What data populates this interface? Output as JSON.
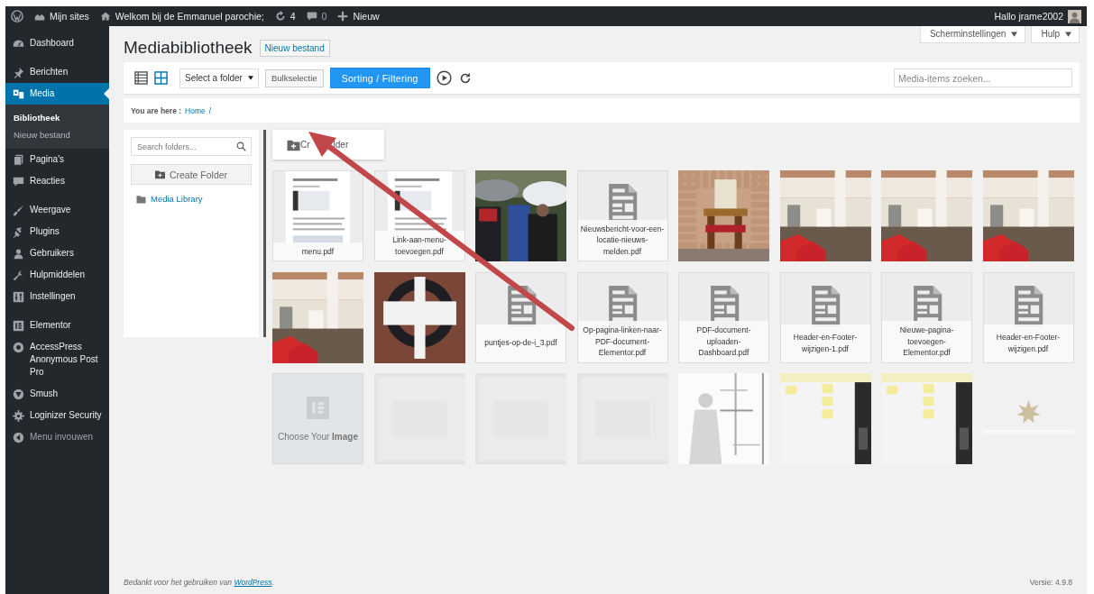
{
  "admin_bar": {
    "my_sites": "Mijn sites",
    "site_name": "Welkom bij de Emmanuel parochie;",
    "updates": "4",
    "comments": "0",
    "new": "Nieuw",
    "greeting": "Hallo jrame2002"
  },
  "sidebar": {
    "groups": [
      {
        "items": [
          {
            "label": "Dashboard",
            "selected": false
          }
        ]
      },
      {
        "items": [
          {
            "label": "Berichten",
            "selected": false
          },
          {
            "label": "Media",
            "selected": true,
            "children": [
              {
                "label": "Bibliotheek",
                "selected": true
              },
              {
                "label": "Nieuw bestand",
                "selected": false
              }
            ]
          },
          {
            "label": "Pagina's",
            "selected": false
          },
          {
            "label": "Reacties",
            "selected": false
          }
        ]
      },
      {
        "items": [
          {
            "label": "Weergave",
            "selected": false
          },
          {
            "label": "Plugins",
            "selected": false
          },
          {
            "label": "Gebruikers",
            "selected": false
          },
          {
            "label": "Hulpmiddelen",
            "selected": false
          },
          {
            "label": "Instellingen",
            "selected": false
          }
        ]
      },
      {
        "items": [
          {
            "label": "Elementor",
            "selected": false
          },
          {
            "label": "AccessPress Anonymous Post Pro",
            "selected": false
          },
          {
            "label": "Smush",
            "selected": false
          },
          {
            "label": "Loginizer Security",
            "selected": false
          },
          {
            "label": "Menu invouwen",
            "selected": false
          }
        ]
      }
    ]
  },
  "header": {
    "title": "Mediabibliotheek",
    "add_button": "Nieuw bestand",
    "screen_tabs": [
      "Scherminstellingen",
      "Hulp"
    ]
  },
  "toolbar": {
    "views": [
      {
        "selected": false
      },
      {
        "selected": true
      }
    ],
    "folder_select": "Select a folder",
    "bulk_button": "Bulkselectie",
    "sort_button": "Sorting / Filtering",
    "search": {
      "placeholder": "Media-items zoeken..."
    }
  },
  "breadcrumb": {
    "label": "You are here :",
    "links": [
      "Home"
    ],
    "separator": "/"
  },
  "folders": {
    "search": {
      "placeholder": "Search folders..."
    },
    "create_button": "Create Folder",
    "tree": [
      {
        "label": "Media Library"
      }
    ]
  },
  "grid": {
    "create_button": [
      "Cr",
      "lder"
    ],
    "tiles": [
      {
        "kind": "preview",
        "name": "menu.pdf"
      },
      {
        "kind": "preview",
        "name": "Link-aan-menu-toevoegen.pdf"
      },
      {
        "kind": "picture"
      },
      {
        "kind": "file",
        "name": "Nieuwsbericht-voor-een-locatie-nieuws-melden.pdf"
      },
      {
        "kind": "picture"
      },
      {
        "kind": "picture"
      },
      {
        "kind": "picture"
      },
      {
        "kind": "picture"
      },
      {
        "kind": "picture"
      },
      {
        "kind": "picture"
      },
      {
        "kind": "file",
        "name": "puntjes-op-de-i_3.pdf"
      },
      {
        "kind": "file",
        "name": "Op-pagina-linken-naar-PDF-document-Elementor.pdf"
      },
      {
        "kind": "file",
        "name": "PDF-document-uploaden-Dashboard.pdf"
      },
      {
        "kind": "file",
        "name": "Header-en-Footer-wijzigen-1.pdf"
      },
      {
        "kind": "file",
        "name": "Nieuwe-pagina-toevoegen-Elementor.pdf"
      },
      {
        "kind": "file",
        "name": "Header-en-Footer-wijzigen.pdf"
      },
      {
        "kind": "placeholder",
        "label": "Choose Your **Image**"
      },
      {
        "kind": "picture"
      },
      {
        "kind": "picture"
      },
      {
        "kind": "picture"
      },
      {
        "kind": "picture"
      },
      {
        "kind": "picture"
      },
      {
        "kind": "picture"
      },
      {
        "kind": "picture"
      }
    ]
  },
  "footer": {
    "thanks": "Bedankt voor het gebruiken van",
    "link": "WordPress",
    "end": ".",
    "version": "Versie: 4.9.8"
  }
}
